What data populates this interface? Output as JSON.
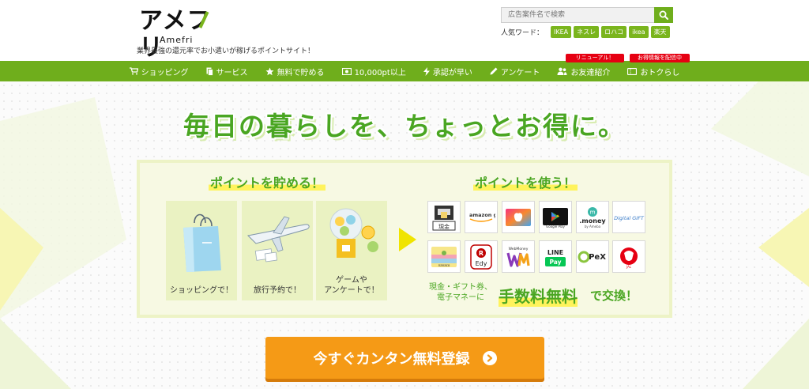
{
  "header": {
    "logo_text": "アメフリ",
    "logo_sub": "Amefri",
    "tagline": "業界最強の還元率でお小遣いが稼げるポイントサイト！",
    "search": {
      "placeholder": "広告案件名で検索"
    },
    "popular_label": "人気ワード：",
    "popular_words": [
      "IKEA",
      "ネスレ",
      "ロハコ",
      "ikea",
      "楽天"
    ],
    "badges": {
      "renewal": "リニューアル！",
      "info": "お得情報を配信中"
    }
  },
  "nav": {
    "items": [
      {
        "label": "ショッピング",
        "icon": "cart-icon"
      },
      {
        "label": "サービス",
        "icon": "document-icon"
      },
      {
        "label": "無料で貯める",
        "icon": "star-icon"
      },
      {
        "label": "10,000pt以上",
        "icon": "money-icon"
      },
      {
        "label": "承認が早い",
        "icon": "bolt-icon"
      },
      {
        "label": "アンケート",
        "icon": "pencil-icon"
      },
      {
        "label": "お友達紹介",
        "icon": "users-icon"
      },
      {
        "label": "おトクらし",
        "icon": "ticket-icon"
      }
    ]
  },
  "hero": {
    "headline": "毎日の暮らしを、ちょっとお得に。",
    "earn_heading": "ポイントを貯める！",
    "use_heading": "ポイントを使う！",
    "earn_cards": [
      {
        "label": "ショッピングで！",
        "icon": "shopping-bag-icon"
      },
      {
        "label": "旅行予約で！",
        "icon": "airplane-icon"
      },
      {
        "label_line1": "ゲームや",
        "label_line2": "アンケートで！",
        "icon": "gacha-icon"
      }
    ],
    "exchange_options": [
      {
        "label": "現金",
        "icon": "atm-icon"
      },
      {
        "label": "amazon gift",
        "icon": "amazon-gift-icon"
      },
      {
        "label": "",
        "icon": "apple-gift-icon"
      },
      {
        "label": "Google Play",
        "icon": "google-play-icon"
      },
      {
        "label": ".money",
        "icon": "dot-money-icon"
      },
      {
        "label": "Digital GIFT",
        "icon": "digital-gift-icon"
      },
      {
        "label": "nanaco",
        "icon": "nanaco-icon"
      },
      {
        "label": "Edy",
        "icon": "edy-icon"
      },
      {
        "label": "WebMoney",
        "icon": "webmoney-icon"
      },
      {
        "label": "LINE Pay",
        "icon": "line-pay-icon"
      },
      {
        "label": "PeX",
        "icon": "pex-icon"
      },
      {
        "label": "JAL",
        "icon": "jal-icon"
      }
    ],
    "exchange_small_line1": "現金・ギフト券、",
    "exchange_small_line2": "電子マネーに",
    "exchange_big": "手数料無料",
    "exchange_tail": "で交換！",
    "cta_label": "今すぐカンタン無料登録"
  },
  "colors": {
    "brand_green": "#6fae1c",
    "headline_green": "#4aa622",
    "cta_orange": "#f59a16",
    "badge_red": "#e60012",
    "highlight_yellow": "#fff35c"
  }
}
